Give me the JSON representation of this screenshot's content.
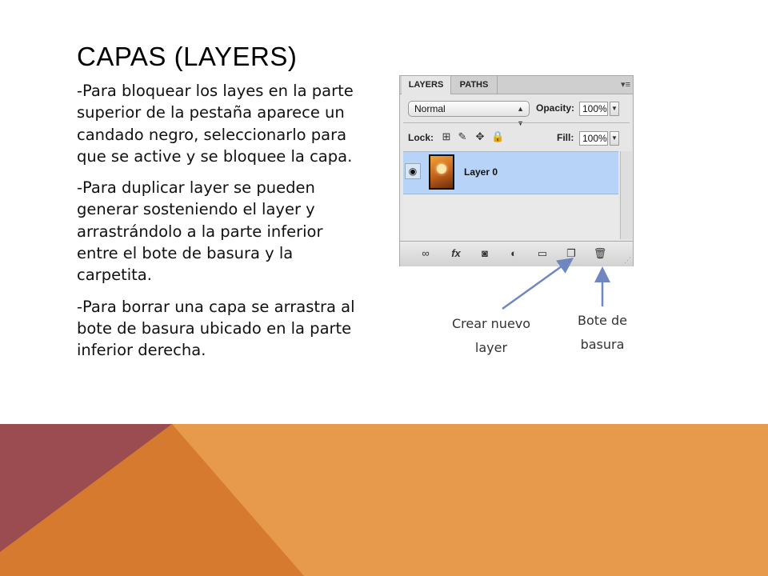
{
  "slide": {
    "title": "CAPAS (LAYERS)",
    "paragraphs": [
      "-Para bloquear los layes en la parte superior de la pestaña aparece un candado negro, seleccionarlo para que se active y se bloquee la capa.",
      "-Para duplicar layer se pueden generar sosteniendo el layer y arrastrándolo a la parte inferior entre el bote de basura y la carpetita.",
      "-Para borrar una capa se arrastra al bote de basura ubicado en la parte inferior derecha."
    ],
    "colors": {
      "background": "#ffffff",
      "band_orange": "#e89a4c",
      "band_dark_orange": "#d67a30",
      "band_maroon": "#9a4c50",
      "arrow": "#6f86bf"
    }
  },
  "panel": {
    "tabs": [
      "LAYERS",
      "PATHS"
    ],
    "menu_icon": "panel-menu-icon",
    "blend_mode": "Normal",
    "opacity_label": "Opacity:",
    "opacity_value": "100%",
    "lock_label": "Lock:",
    "lock_icons": [
      "lock-transparent-icon",
      "lock-image-icon",
      "lock-position-icon",
      "lock-all-icon"
    ],
    "fill_label": "Fill:",
    "fill_value": "100%",
    "layer": {
      "name": "Layer 0",
      "visibility_icon": "eye-icon"
    },
    "bottom_icons": [
      "link-icon",
      "fx-icon",
      "mask-icon",
      "adjustment-icon",
      "folder-icon",
      "new-layer-icon",
      "trash-icon"
    ]
  },
  "callouts": {
    "new_layer": "Crear nuevo layer",
    "trash": "Bote de basura"
  }
}
